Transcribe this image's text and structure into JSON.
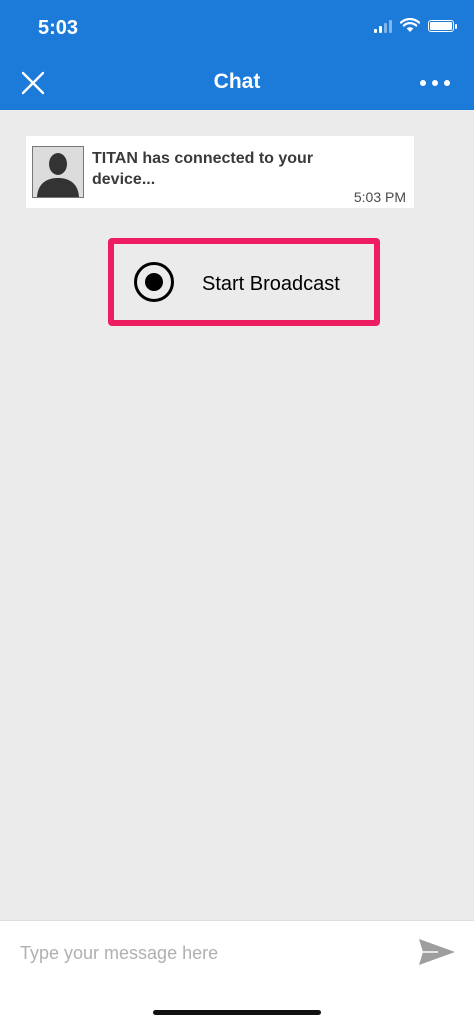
{
  "status_bar": {
    "time": "5:03"
  },
  "header": {
    "title": "Chat"
  },
  "message": {
    "text": "TITAN has connected to your device...",
    "time": "5:03 PM"
  },
  "broadcast": {
    "label": "Start Broadcast",
    "accent_color": "#ee1d62"
  },
  "composer": {
    "placeholder": "Type your message here",
    "value": ""
  },
  "colors": {
    "header": "#1c7ad9",
    "background": "#ebebeb"
  }
}
